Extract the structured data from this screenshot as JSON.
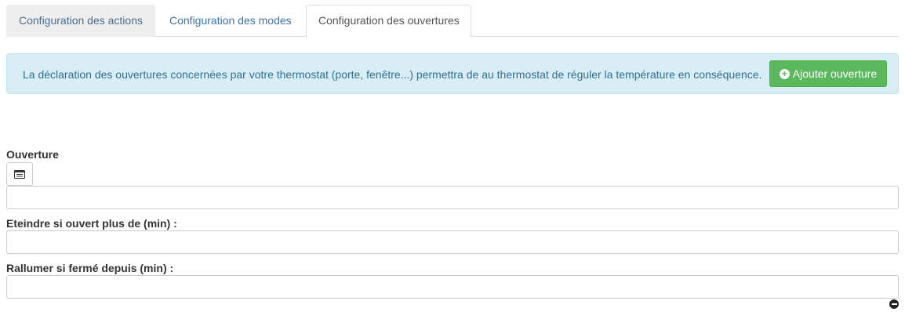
{
  "tabs": [
    {
      "label": "Configuration des actions"
    },
    {
      "label": "Configuration des modes"
    },
    {
      "label": "Configuration des ouvertures",
      "active": true
    }
  ],
  "alert": {
    "text": "La déclaration des ouvertures concernées par votre thermostat (porte, fenêtre...) permettra de au thermostat de réguler la température en conséquence.",
    "button_label": "Ajouter ouverture",
    "button_icon": "plus-circle-icon"
  },
  "form": {
    "ouverture_label": "Ouverture",
    "ouverture_value": "",
    "list_button_icon": "list-alt-icon",
    "eteindre_label": "Eteindre si ouvert plus de (min) :",
    "eteindre_value": "",
    "rallumer_label": "Rallumer si fermé depuis (min) :",
    "rallumer_value": "",
    "remove_icon": "minus-circle-icon"
  },
  "colors": {
    "alert_bg": "#d9edf7",
    "alert_text": "#31708f",
    "success": "#5cb85c",
    "link": "#337ab7"
  }
}
